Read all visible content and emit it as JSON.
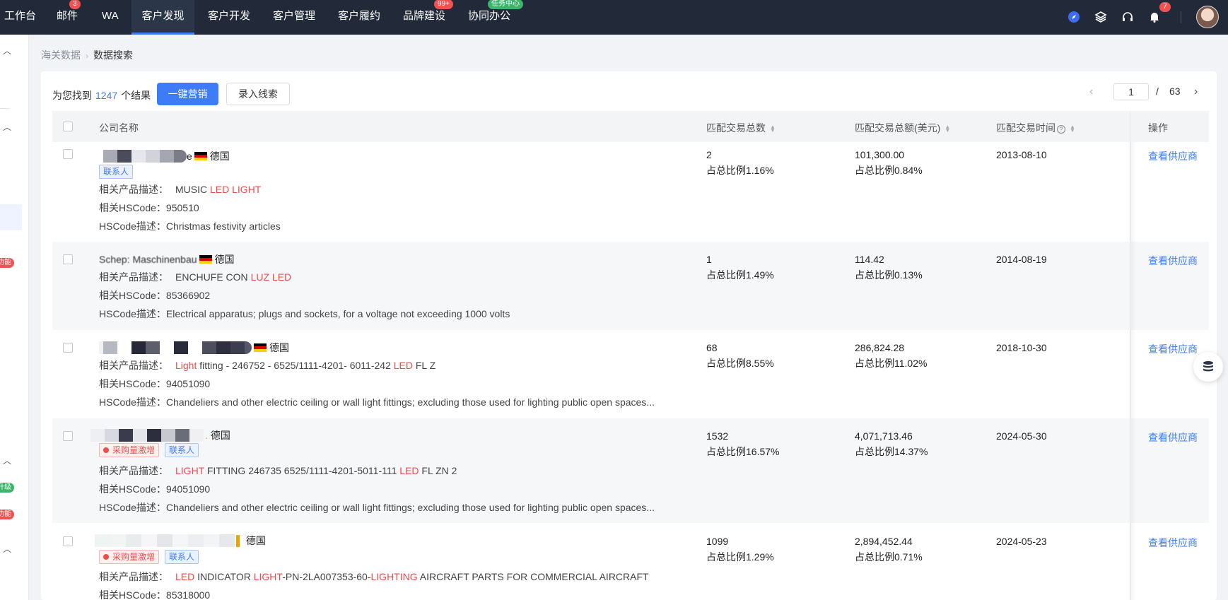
{
  "topnav": {
    "items": [
      {
        "label": "工作台"
      },
      {
        "label": "邮件",
        "badge": "3"
      },
      {
        "label": "WA"
      },
      {
        "label": "客户发现"
      },
      {
        "label": "客户开发"
      },
      {
        "label": "客户管理"
      },
      {
        "label": "客户履约"
      },
      {
        "label": "品牌建设",
        "badge": "99+"
      },
      {
        "label": "协同办公",
        "badge": "任务中心"
      }
    ],
    "active": "客户发现",
    "notification_badge": "7"
  },
  "left_strip": {
    "pills": [
      "功能",
      "升级",
      "功能"
    ]
  },
  "breadcrumb": {
    "root": "海关数据",
    "current": "数据搜索"
  },
  "results": {
    "prefix": "为您找到",
    "count": "1247",
    "suffix": "个结果"
  },
  "toolbar": {
    "primary_label": "一键营销",
    "secondary_label": "录入线索"
  },
  "pagination": {
    "current": "1",
    "separator": "/",
    "total": "63"
  },
  "table": {
    "headers": {
      "company": "公司名称",
      "count": "匹配交易总数",
      "amount": "匹配交易总额(美元)",
      "time": "匹配交易时间",
      "action": "操作"
    },
    "rows": [
      {
        "company_visible": "e",
        "country": "德国",
        "tags": [
          "联系人"
        ],
        "desc_label": "相关产品描述：",
        "desc": [
          {
            "t": "MUSIC "
          },
          {
            "t": "LED",
            "hl": true
          },
          {
            "t": " "
          },
          {
            "t": "LIGHT",
            "hl": true
          }
        ],
        "hscode_label": "相关HSCode：",
        "hscode": "950510",
        "hsdesc_label": "HSCode描述：",
        "hsdesc": "Christmas festivity articles",
        "count": "2",
        "count_ratio": "占总比例1.16%",
        "amount": "101,300.00",
        "amount_ratio": "占总比例0.84%",
        "time": "2013-08-10",
        "action": "查看供应商"
      },
      {
        "company_visible": "Schep: Maschinenbau",
        "country": "德国",
        "tags": [],
        "desc_label": "相关产品描述：",
        "desc": [
          {
            "t": "ENCHUFE CON "
          },
          {
            "t": "LUZ",
            "hl": true
          },
          {
            "t": " "
          },
          {
            "t": "LED",
            "hl": true
          }
        ],
        "hscode_label": "相关HSCode：",
        "hscode": "85366902",
        "hsdesc_label": "HSCode描述：",
        "hsdesc": "Electrical apparatus; plugs and sockets, for a voltage not exceeding 1000 volts",
        "count": "1",
        "count_ratio": "占总比例1.49%",
        "amount": "114.42",
        "amount_ratio": "占总比例0.13%",
        "time": "2014-08-19",
        "action": "查看供应商"
      },
      {
        "company_visible": "",
        "country": "德国",
        "tags": [],
        "desc_label": "相关产品描述：",
        "desc": [
          {
            "t": "Light",
            "hl": true
          },
          {
            "t": " fitting - 246752 - 6525/1111-4201- 6011-242 "
          },
          {
            "t": "LED",
            "hl": true
          },
          {
            "t": " FL Z"
          }
        ],
        "hscode_label": "相关HSCode：",
        "hscode": "94051090",
        "hsdesc_label": "HSCode描述：",
        "hsdesc": "Chandeliers and other electric ceiling or wall light fittings; excluding those used for lighting public open spaces...",
        "count": "68",
        "count_ratio": "占总比例8.55%",
        "amount": "286,824.28",
        "amount_ratio": "占总比例11.02%",
        "time": "2018-10-30",
        "action": "查看供应商"
      },
      {
        "company_visible": "",
        "country": "德国",
        "tags": [
          "采购量激增",
          "联系人"
        ],
        "desc_label": "相关产品描述：",
        "desc": [
          {
            "t": "LIGHT",
            "hl": true
          },
          {
            "t": " FITTING 246735 6525/1111-4201-5011-111 "
          },
          {
            "t": "LED",
            "hl": true
          },
          {
            "t": " FL ZN 2"
          }
        ],
        "hscode_label": "相关HSCode：",
        "hscode": "94051090",
        "hsdesc_label": "HSCode描述：",
        "hsdesc": "Chandeliers and other electric ceiling or wall light fittings; excluding those used for lighting public open spaces...",
        "count": "1532",
        "count_ratio": "占总比例16.57%",
        "amount": "4,071,713.46",
        "amount_ratio": "占总比例14.37%",
        "time": "2024-05-30",
        "action": "查看供应商"
      },
      {
        "company_visible": "",
        "country": "德国",
        "tags": [
          "采购量激增",
          "联系人"
        ],
        "desc_label": "相关产品描述：",
        "desc": [
          {
            "t": "LED",
            "hl": true
          },
          {
            "t": " INDICATOR "
          },
          {
            "t": "LIGHT",
            "hl": true
          },
          {
            "t": "-PN-2LA007353-60-"
          },
          {
            "t": "LIGHTING",
            "hl": true
          },
          {
            "t": " AIRCRAFT PARTS FOR COMMERCIAL AIRCRAFT"
          }
        ],
        "hscode_label": "相关HSCode：",
        "hscode": "85318000",
        "hsdesc_label": "",
        "hsdesc": "",
        "count": "1099",
        "count_ratio": "占总比例1.29%",
        "amount": "2,894,452.44",
        "amount_ratio": "占总比例0.71%",
        "time": "2024-05-23",
        "action": "查看供应商"
      }
    ]
  },
  "colors": {
    "accent": "#3d7cf6",
    "highlight": "#f04b4b",
    "topbar": "#222a3a"
  }
}
